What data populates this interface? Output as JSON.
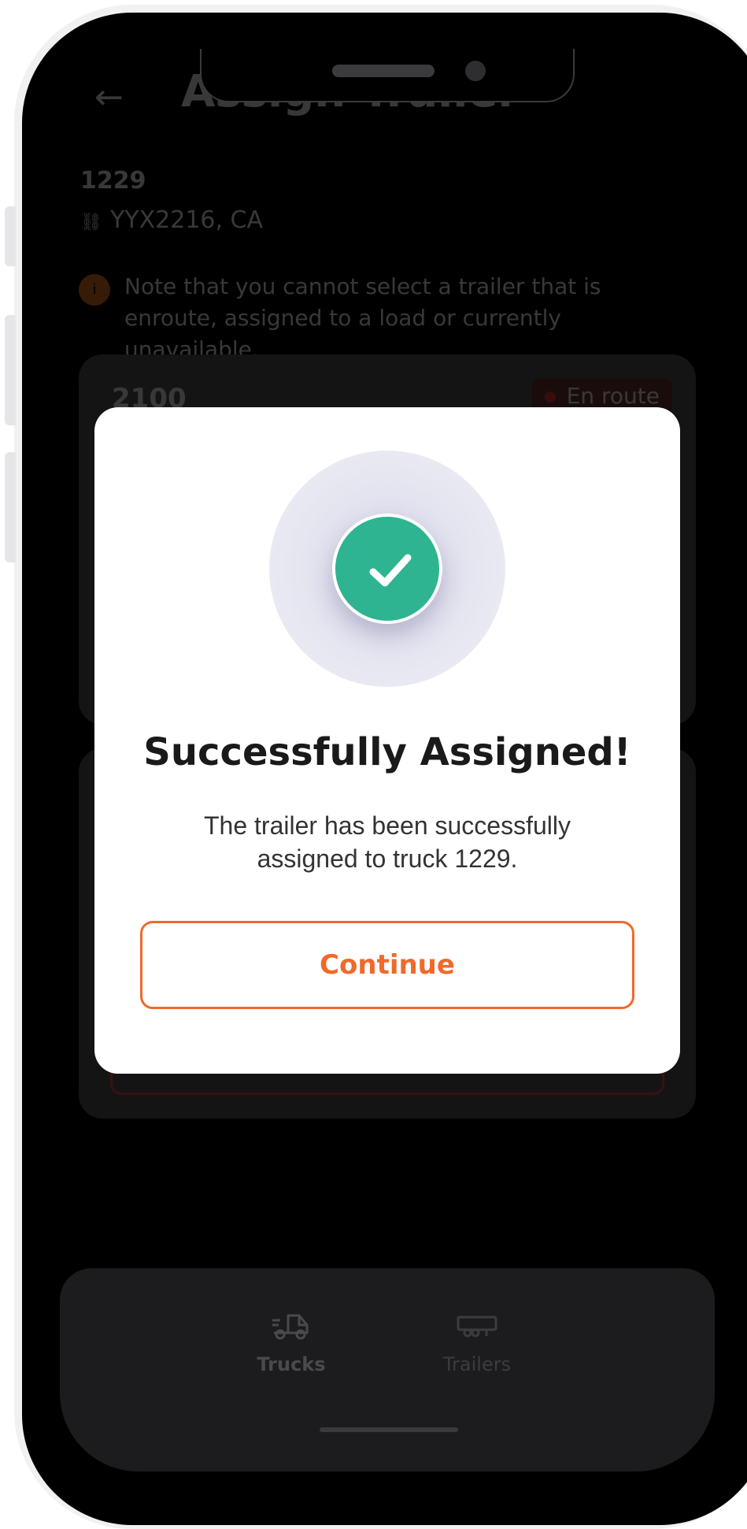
{
  "header": {
    "back_icon": "arrow-left-icon",
    "title": "Assign Trailer"
  },
  "truck": {
    "number": "1229",
    "plate": "YYX2216, CA"
  },
  "note": {
    "icon": "info-icon",
    "text": "Note that you cannot select a trailer that is enroute, assigned to a load or currently unavailable."
  },
  "trailer_card": {
    "number": "2100",
    "status": "En route",
    "status_color": "#ff3b30"
  },
  "modal": {
    "icon": "check-icon",
    "icon_color": "#2eb490",
    "title": "Successfully Assigned!",
    "description": "The trailer has been successfully assigned to truck 1229.",
    "continue_label": "Continue",
    "accent_color": "#ef6a2c"
  },
  "bottom_nav": {
    "items": [
      {
        "label": "Trucks",
        "icon": "truck-icon",
        "active": true
      },
      {
        "label": "Trailers",
        "icon": "trailer-icon",
        "active": false
      }
    ]
  }
}
